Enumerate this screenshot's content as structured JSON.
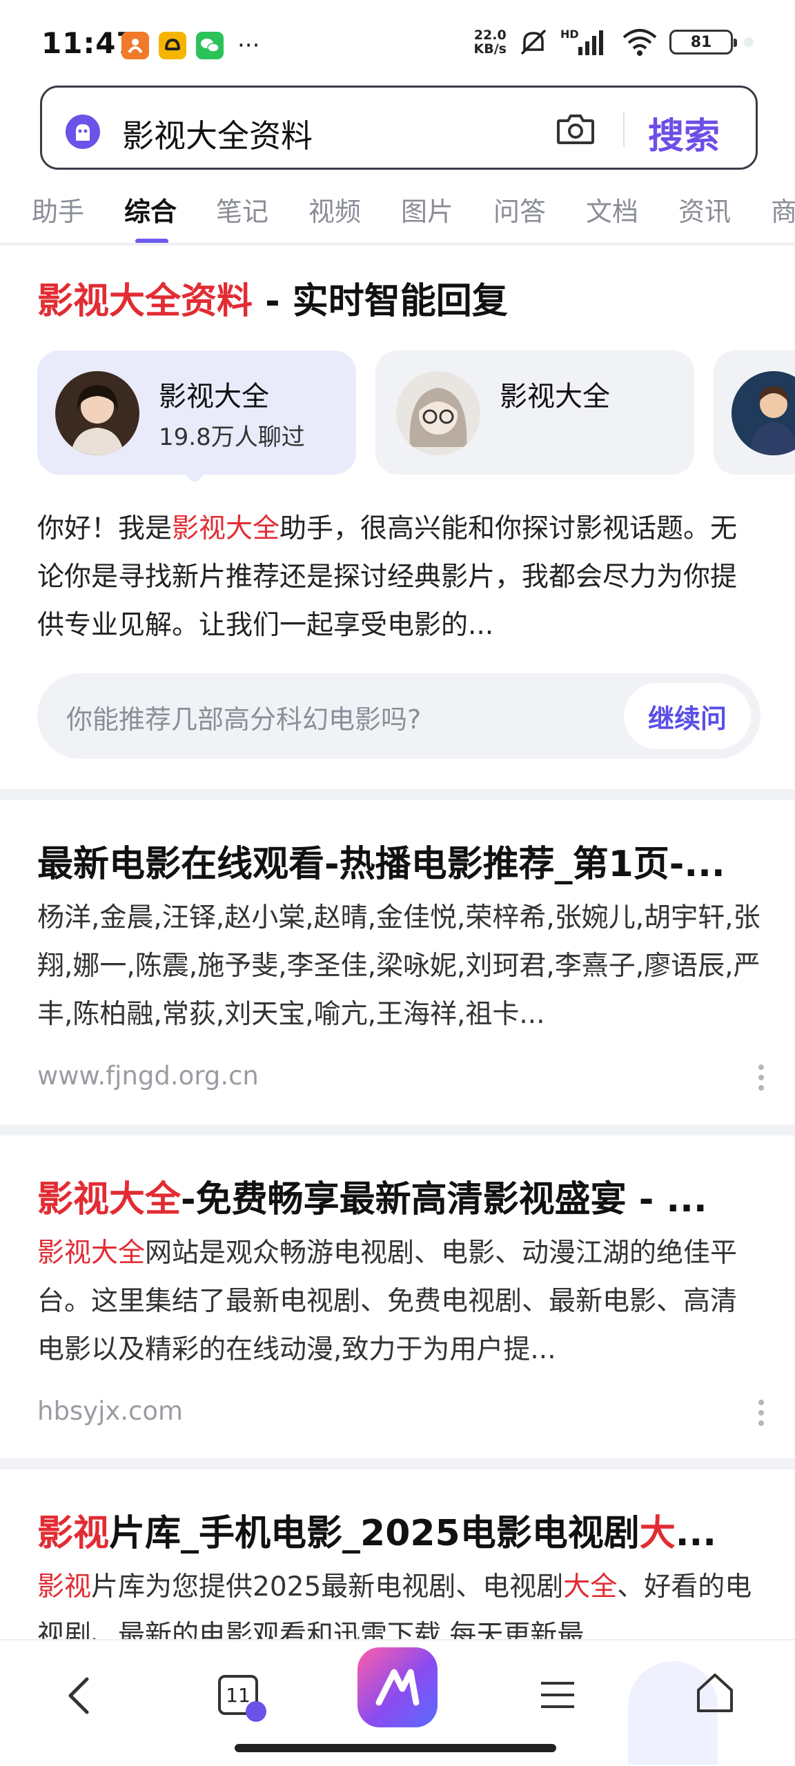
{
  "status_bar": {
    "time": "11:47",
    "net_speed_value": "22.0",
    "net_speed_unit": "KB/s",
    "battery": "81",
    "network_label": "HD"
  },
  "search": {
    "query": "影视大全资料",
    "button_label": "搜索"
  },
  "tabs": [
    {
      "label": "助手"
    },
    {
      "label": "综合"
    },
    {
      "label": "笔记"
    },
    {
      "label": "视频"
    },
    {
      "label": "图片"
    },
    {
      "label": "问答"
    },
    {
      "label": "文档"
    },
    {
      "label": "资讯"
    },
    {
      "label": "商"
    }
  ],
  "active_tab": "综合",
  "ai_card": {
    "title_highlight": "影视大全资料",
    "title_rest": " - 实时智能回复",
    "personas": [
      {
        "name": "影视大全",
        "subtitle": "19.8万人聊过"
      },
      {
        "name": "影视大全",
        "subtitle": ""
      }
    ],
    "body_prefix": "你好！我是",
    "body_highlight": "影视大全",
    "body_rest": "助手，很高兴能和你探讨影视话题。无论你是寻找新片推荐还是探讨经典影片，我都会尽力为你提供专业见解。让我们一起享受电影的...",
    "followup_question": "你能推荐几部高分科幻电影吗?",
    "followup_button": "继续问"
  },
  "results": [
    {
      "title_highlight": "",
      "title_rest": "最新电影在线观看-热播电影推荐_第1页-...",
      "snippet_highlight": "",
      "snippet_rest": "杨洋,金晨,汪铎,赵小棠,赵晴,金佳悦,荣梓希,张婉儿,胡宇轩,张翔,娜一,陈震,施予斐,李圣佳,梁咏妮,刘珂君,李熹子,廖语辰,严丰,陈柏融,常荻,刘天宝,喻亢,王海祥,祖卡...",
      "source": "www.fjngd.org.cn"
    },
    {
      "title_highlight": "影视大全",
      "title_rest": "-免费畅享最新高清影视盛宴 - ...",
      "snippet_highlight": "影视大全",
      "snippet_rest": "网站是观众畅游电视剧、电影、动漫江湖的绝佳平台。这里集结了最新电视剧、免费电视剧、最新电影、高清电影以及精彩的在线动漫,致力于为用户提...",
      "source": "hbsyjx.com"
    },
    {
      "title_highlight": "影视",
      "title_rest": "片库_手机电影_2025电影电视剧",
      "title_highlight_2": "大",
      "title_tail": "...",
      "snippet_highlight": "影视",
      "snippet_rest": "片库为您提供2025最新电视剧、电视剧",
      "snippet_highlight_2": "大全",
      "snippet_tail": "、好看的电视剧、最新的电影观看和迅雷下载,每天更新最..."
    }
  ],
  "bottom_nav": {
    "tab_count": "11"
  },
  "colors": {
    "accent": "#6e4ee6",
    "highlight_red": "#e22c33",
    "background": "#f1f2f5"
  }
}
